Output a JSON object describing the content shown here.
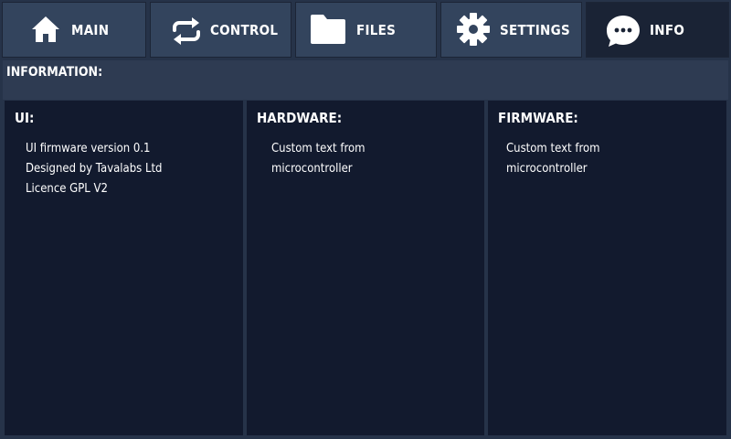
{
  "tabs": [
    {
      "label": "MAIN",
      "icon": "home-icon"
    },
    {
      "label": "CONTROL",
      "icon": "refresh-icon"
    },
    {
      "label": "FILES",
      "icon": "folder-icon"
    },
    {
      "label": "SETTINGS",
      "icon": "gear-icon"
    },
    {
      "label": "INFO",
      "icon": "chat-icon"
    }
  ],
  "active_tab": "INFO",
  "header": {
    "title": "INFORMATION:"
  },
  "panels": {
    "ui": {
      "title": "UI:",
      "lines": [
        "UI firmware version 0.1",
        "Designed by Tavalabs Ltd",
        "Licence GPL V2"
      ]
    },
    "hardware": {
      "title": "HARDWARE:",
      "lines": [
        "Custom text from",
        "microcontroller"
      ]
    },
    "firmware": {
      "title": "FIRMWARE:",
      "lines": [
        "Custom text from",
        "microcontroller"
      ]
    }
  },
  "colors": {
    "background": "#263349",
    "tab": "#33445d",
    "tab_active": "#1a2335",
    "header": "#2e3b52",
    "panel": "#121a2e",
    "text": "#ffffff"
  }
}
